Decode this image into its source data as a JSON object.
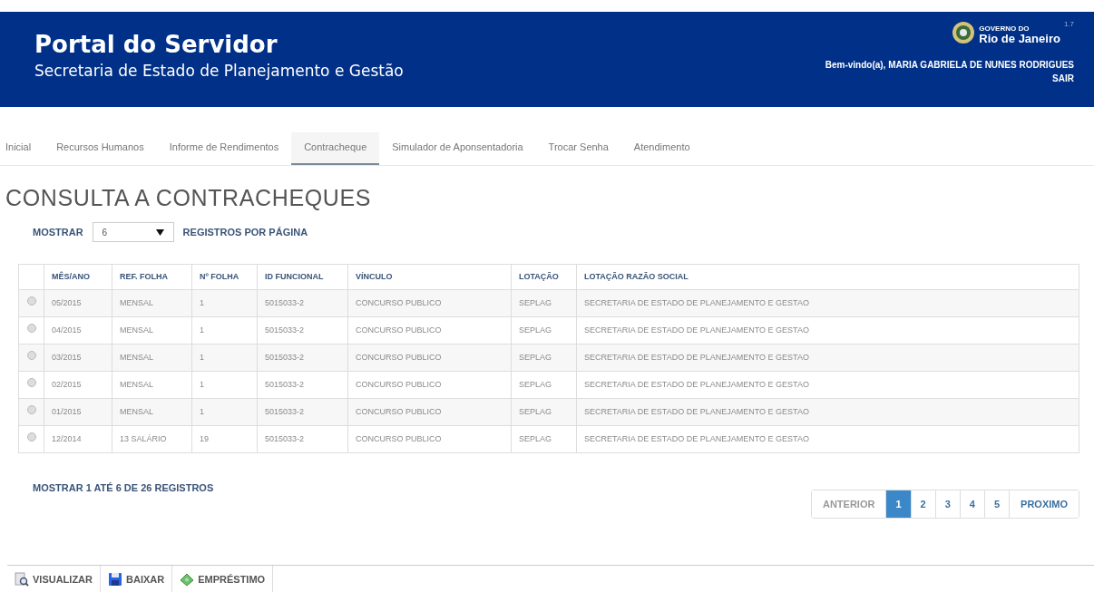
{
  "header": {
    "title": "Portal do Servidor",
    "subtitle": "Secretaria de Estado de Planejamento e Gestão",
    "logo_small": "GOVERNO DO",
    "logo_big": "Rio de Janeiro",
    "version": "1.7",
    "welcome": "Bem-vindo(a), MARIA GABRIELA DE NUNES RODRIGUES",
    "logout": "SAIR"
  },
  "nav": [
    {
      "label": "Inicial",
      "selected": false
    },
    {
      "label": "Recursos Humanos",
      "selected": false
    },
    {
      "label": "Informe de Rendimentos",
      "selected": false
    },
    {
      "label": "Contracheque",
      "selected": true
    },
    {
      "label": "Simulador de Aponsentadoria",
      "selected": false
    },
    {
      "label": "Trocar Senha",
      "selected": false
    },
    {
      "label": "Atendimento",
      "selected": false
    }
  ],
  "page_title": "CONSULTA A CONTRACHEQUES",
  "page_size": {
    "before": "MOSTRAR",
    "value": "6",
    "after": "REGISTROS POR PÁGINA"
  },
  "table": {
    "columns": [
      "MÊS/ANO",
      "REF. FOLHA",
      "Nº FOLHA",
      "ID FUNCIONAL",
      "VÍNCULO",
      "LOTAÇÃO",
      "LOTAÇÃO RAZÃO SOCIAL"
    ],
    "rows": [
      {
        "selected": false,
        "cells": [
          "05/2015",
          "MENSAL",
          "1",
          "5015033-2",
          "CONCURSO PUBLICO",
          "SEPLAG",
          "SECRETARIA DE ESTADO DE PLANEJAMENTO E GESTAO"
        ]
      },
      {
        "selected": false,
        "cells": [
          "04/2015",
          "MENSAL",
          "1",
          "5015033-2",
          "CONCURSO PUBLICO",
          "SEPLAG",
          "SECRETARIA DE ESTADO DE PLANEJAMENTO E GESTAO"
        ]
      },
      {
        "selected": false,
        "cells": [
          "03/2015",
          "MENSAL",
          "1",
          "5015033-2",
          "CONCURSO PUBLICO",
          "SEPLAG",
          "SECRETARIA DE ESTADO DE PLANEJAMENTO E GESTAO"
        ]
      },
      {
        "selected": false,
        "cells": [
          "02/2015",
          "MENSAL",
          "1",
          "5015033-2",
          "CONCURSO PUBLICO",
          "SEPLAG",
          "SECRETARIA DE ESTADO DE PLANEJAMENTO E GESTAO"
        ]
      },
      {
        "selected": false,
        "cells": [
          "01/2015",
          "MENSAL",
          "1",
          "5015033-2",
          "CONCURSO PUBLICO",
          "SEPLAG",
          "SECRETARIA DE ESTADO DE PLANEJAMENTO E GESTAO"
        ]
      },
      {
        "selected": false,
        "cells": [
          "12/2014",
          "13 SALÁRIO",
          "19",
          "5015033-2",
          "CONCURSO PUBLICO",
          "SEPLAG",
          "SECRETARIA DE ESTADO DE PLANEJAMENTO E GESTAO"
        ]
      }
    ]
  },
  "summary": "MOSTRAR 1 ATÉ 6 DE 26 REGISTROS",
  "pagination": [
    {
      "label": "ANTERIOR",
      "kind": "nav",
      "disabled": true,
      "selected": false
    },
    {
      "label": "1",
      "kind": "page",
      "disabled": false,
      "selected": true
    },
    {
      "label": "2",
      "kind": "page",
      "disabled": false,
      "selected": false
    },
    {
      "label": "3",
      "kind": "page",
      "disabled": false,
      "selected": false
    },
    {
      "label": "4",
      "kind": "page",
      "disabled": false,
      "selected": false
    },
    {
      "label": "5",
      "kind": "page",
      "disabled": false,
      "selected": false
    },
    {
      "label": "PROXIMO",
      "kind": "nav",
      "disabled": false,
      "selected": false
    }
  ],
  "actions": [
    {
      "label": "VISUALIZAR",
      "kind": "view"
    },
    {
      "label": "BAIXAR",
      "kind": "download"
    },
    {
      "label": "EMPRÉSTIMO",
      "kind": "loan"
    }
  ]
}
